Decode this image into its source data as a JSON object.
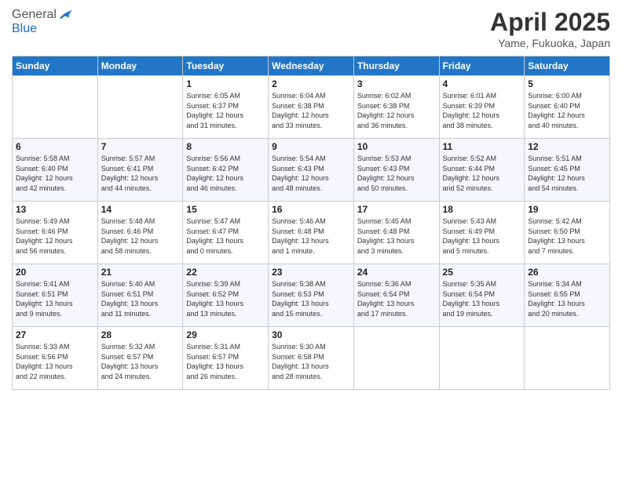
{
  "logo": {
    "general": "General",
    "blue": "Blue"
  },
  "header": {
    "title": "April 2025",
    "subtitle": "Yame, Fukuoka, Japan"
  },
  "weekdays": [
    "Sunday",
    "Monday",
    "Tuesday",
    "Wednesday",
    "Thursday",
    "Friday",
    "Saturday"
  ],
  "weeks": [
    [
      {
        "day": "",
        "info": ""
      },
      {
        "day": "",
        "info": ""
      },
      {
        "day": "1",
        "info": "Sunrise: 6:05 AM\nSunset: 6:37 PM\nDaylight: 12 hours\nand 31 minutes."
      },
      {
        "day": "2",
        "info": "Sunrise: 6:04 AM\nSunset: 6:38 PM\nDaylight: 12 hours\nand 33 minutes."
      },
      {
        "day": "3",
        "info": "Sunrise: 6:02 AM\nSunset: 6:38 PM\nDaylight: 12 hours\nand 36 minutes."
      },
      {
        "day": "4",
        "info": "Sunrise: 6:01 AM\nSunset: 6:39 PM\nDaylight: 12 hours\nand 38 minutes."
      },
      {
        "day": "5",
        "info": "Sunrise: 6:00 AM\nSunset: 6:40 PM\nDaylight: 12 hours\nand 40 minutes."
      }
    ],
    [
      {
        "day": "6",
        "info": "Sunrise: 5:58 AM\nSunset: 6:40 PM\nDaylight: 12 hours\nand 42 minutes."
      },
      {
        "day": "7",
        "info": "Sunrise: 5:57 AM\nSunset: 6:41 PM\nDaylight: 12 hours\nand 44 minutes."
      },
      {
        "day": "8",
        "info": "Sunrise: 5:56 AM\nSunset: 6:42 PM\nDaylight: 12 hours\nand 46 minutes."
      },
      {
        "day": "9",
        "info": "Sunrise: 5:54 AM\nSunset: 6:43 PM\nDaylight: 12 hours\nand 48 minutes."
      },
      {
        "day": "10",
        "info": "Sunrise: 5:53 AM\nSunset: 6:43 PM\nDaylight: 12 hours\nand 50 minutes."
      },
      {
        "day": "11",
        "info": "Sunrise: 5:52 AM\nSunset: 6:44 PM\nDaylight: 12 hours\nand 52 minutes."
      },
      {
        "day": "12",
        "info": "Sunrise: 5:51 AM\nSunset: 6:45 PM\nDaylight: 12 hours\nand 54 minutes."
      }
    ],
    [
      {
        "day": "13",
        "info": "Sunrise: 5:49 AM\nSunset: 6:46 PM\nDaylight: 12 hours\nand 56 minutes."
      },
      {
        "day": "14",
        "info": "Sunrise: 5:48 AM\nSunset: 6:46 PM\nDaylight: 12 hours\nand 58 minutes."
      },
      {
        "day": "15",
        "info": "Sunrise: 5:47 AM\nSunset: 6:47 PM\nDaylight: 13 hours\nand 0 minutes."
      },
      {
        "day": "16",
        "info": "Sunrise: 5:46 AM\nSunset: 6:48 PM\nDaylight: 13 hours\nand 1 minute."
      },
      {
        "day": "17",
        "info": "Sunrise: 5:45 AM\nSunset: 6:48 PM\nDaylight: 13 hours\nand 3 minutes."
      },
      {
        "day": "18",
        "info": "Sunrise: 5:43 AM\nSunset: 6:49 PM\nDaylight: 13 hours\nand 5 minutes."
      },
      {
        "day": "19",
        "info": "Sunrise: 5:42 AM\nSunset: 6:50 PM\nDaylight: 13 hours\nand 7 minutes."
      }
    ],
    [
      {
        "day": "20",
        "info": "Sunrise: 5:41 AM\nSunset: 6:51 PM\nDaylight: 13 hours\nand 9 minutes."
      },
      {
        "day": "21",
        "info": "Sunrise: 5:40 AM\nSunset: 6:51 PM\nDaylight: 13 hours\nand 11 minutes."
      },
      {
        "day": "22",
        "info": "Sunrise: 5:39 AM\nSunset: 6:52 PM\nDaylight: 13 hours\nand 13 minutes."
      },
      {
        "day": "23",
        "info": "Sunrise: 5:38 AM\nSunset: 6:53 PM\nDaylight: 13 hours\nand 15 minutes."
      },
      {
        "day": "24",
        "info": "Sunrise: 5:36 AM\nSunset: 6:54 PM\nDaylight: 13 hours\nand 17 minutes."
      },
      {
        "day": "25",
        "info": "Sunrise: 5:35 AM\nSunset: 6:54 PM\nDaylight: 13 hours\nand 19 minutes."
      },
      {
        "day": "26",
        "info": "Sunrise: 5:34 AM\nSunset: 6:55 PM\nDaylight: 13 hours\nand 20 minutes."
      }
    ],
    [
      {
        "day": "27",
        "info": "Sunrise: 5:33 AM\nSunset: 6:56 PM\nDaylight: 13 hours\nand 22 minutes."
      },
      {
        "day": "28",
        "info": "Sunrise: 5:32 AM\nSunset: 6:57 PM\nDaylight: 13 hours\nand 24 minutes."
      },
      {
        "day": "29",
        "info": "Sunrise: 5:31 AM\nSunset: 6:57 PM\nDaylight: 13 hours\nand 26 minutes."
      },
      {
        "day": "30",
        "info": "Sunrise: 5:30 AM\nSunset: 6:58 PM\nDaylight: 13 hours\nand 28 minutes."
      },
      {
        "day": "",
        "info": ""
      },
      {
        "day": "",
        "info": ""
      },
      {
        "day": "",
        "info": ""
      }
    ]
  ]
}
